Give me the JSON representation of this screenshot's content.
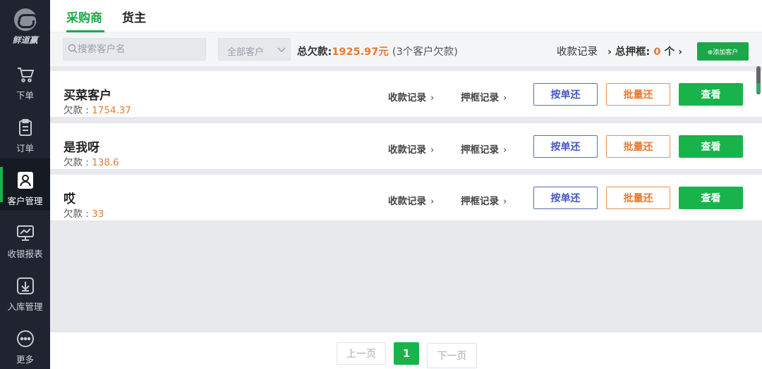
{
  "app": {
    "logo_text": "鲜道赢"
  },
  "sidebar": {
    "items": [
      {
        "label": "下单",
        "icon": "cart-icon"
      },
      {
        "label": "订单",
        "icon": "clipboard-icon"
      },
      {
        "label": "客户管理",
        "icon": "user-icon",
        "active": true
      },
      {
        "label": "收银报表",
        "icon": "monitor-chart-icon"
      },
      {
        "label": "入库管理",
        "icon": "download-box-icon"
      },
      {
        "label": "更多",
        "icon": "more-dots-icon"
      }
    ]
  },
  "tabs": [
    {
      "label": "采购商",
      "active": true
    },
    {
      "label": "货主",
      "active": false
    }
  ],
  "toolbar": {
    "search_placeholder": "搜索客户名",
    "customer_filter": "全部客户",
    "total_label": "总欠款:",
    "total_amount": "1925.97元",
    "total_count": "(3个客户欠款)",
    "records_label": "收款记录",
    "deposit_label": "总押框:",
    "deposit_count": "0",
    "deposit_unit": "个",
    "add_customer_label": "添加客户"
  },
  "customers": [
    {
      "name": "买菜客户",
      "debt_label": "欠款 : ",
      "debt": "1754.37"
    },
    {
      "name": "是我呀",
      "debt_label": "欠款 : ",
      "debt": "138.6"
    },
    {
      "name": "哎",
      "debt_label": "欠款 : ",
      "debt": "33"
    }
  ],
  "row_actions": {
    "payment_records": "收款记录",
    "deposit_records": "押框记录",
    "repay_by_order": "按单还",
    "repay_batch": "批量还",
    "view": "查看"
  },
  "pagination": {
    "prev": "上一页",
    "current": "1",
    "next": "下一页"
  },
  "colors": {
    "accent": "#1ba84a",
    "amount": "#e8792f",
    "by_order": "#4457c4",
    "sidebar_bg": "#1f2430"
  }
}
